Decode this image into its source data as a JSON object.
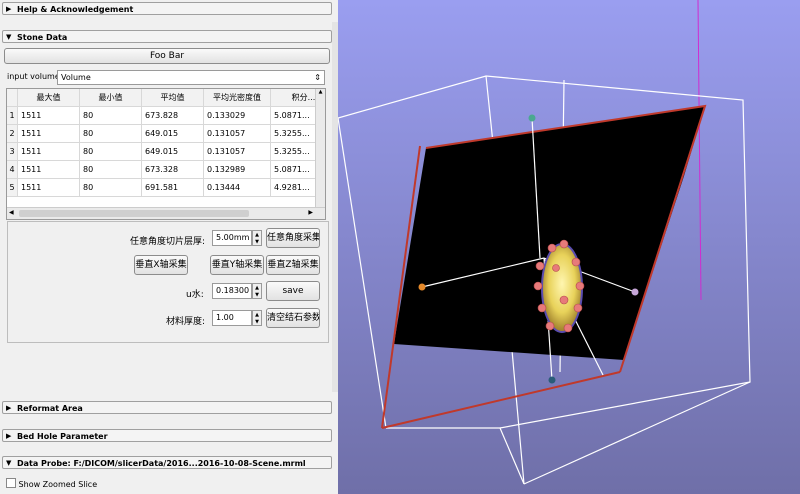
{
  "sections": {
    "help": "Help & Acknowledgement",
    "stone": "Stone Data",
    "reformat": "Reformat Area",
    "bed_hole": "Bed Hole Parameter",
    "data_probe": "Data Probe: F:/DICOM/slicerData/2016...2016-10-08-Scene.mrml"
  },
  "foo_bar": "Foo Bar",
  "input_volume": {
    "label": "input volume",
    "value": "Volume"
  },
  "table": {
    "headers": [
      "最大值",
      "最小值",
      "平均值",
      "平均光密度值",
      "积分..."
    ],
    "rows": [
      {
        "n": "1",
        "c": [
          "1511",
          "80",
          "673.828",
          "0.133029",
          "5.0871..."
        ]
      },
      {
        "n": "2",
        "c": [
          "1511",
          "80",
          "649.015",
          "0.131057",
          "5.3255..."
        ]
      },
      {
        "n": "3",
        "c": [
          "1511",
          "80",
          "649.015",
          "0.131057",
          "5.3255..."
        ]
      },
      {
        "n": "4",
        "c": [
          "1511",
          "80",
          "673.328",
          "0.132989",
          "5.0871..."
        ]
      },
      {
        "n": "5",
        "c": [
          "1511",
          "80",
          "691.581",
          "0.13444",
          "4.9281..."
        ]
      }
    ]
  },
  "controls": {
    "thickness_label": "任意角度切片层厚:",
    "thickness_value": "5.00mm",
    "arbitrary_collect": "任意角度采集",
    "vert_x": "垂直X轴采集",
    "vert_y": "垂直Y轴采集",
    "vert_z": "垂直Z轴采集",
    "u_water_label": "u水:",
    "u_water_value": "0.18300",
    "save": "save",
    "material_label": "材料厚度:",
    "material_value": "1.00",
    "clear": "清空结石参数"
  },
  "show_zoomed": "Show Zoomed Slice",
  "colors": {
    "bg_top": "#9a9ef0",
    "bg_bottom": "#6f6fa8",
    "plane": "#000000",
    "cut_edge": "#c0392b",
    "ellipsoid": "#e8d25a"
  }
}
